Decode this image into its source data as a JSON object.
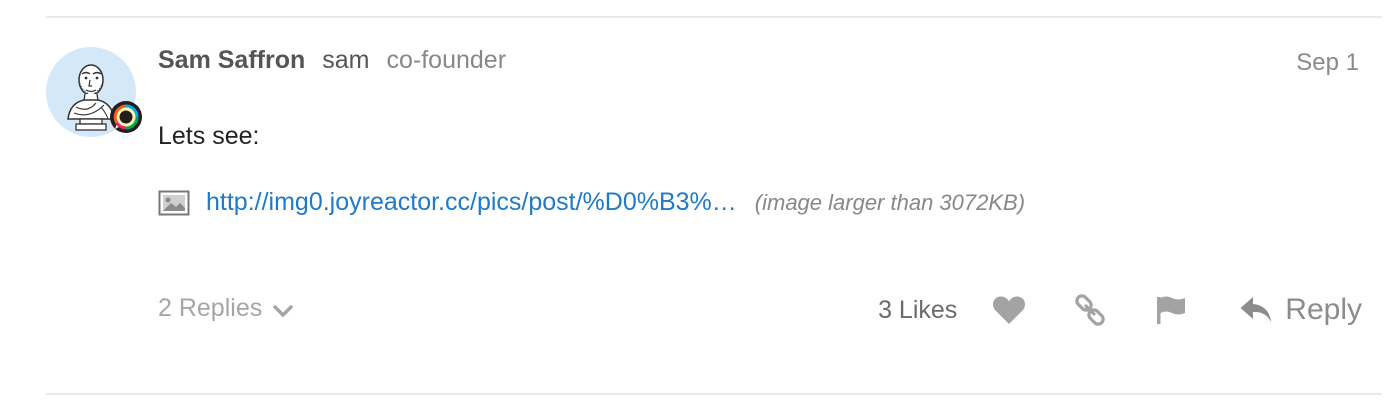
{
  "post": {
    "author": {
      "full_name": "Sam Saffron",
      "username": "sam",
      "title": "co-founder",
      "avatar_icon": "bust-avatar-icon",
      "badge_icon": "discourse-badge-icon"
    },
    "date": "Sep 1",
    "body_text": "Lets see:",
    "onebox": {
      "icon": "image-icon",
      "link_text": "http://img0.joyreactor.cc/pics/post/%D0%B3%…",
      "note": "(image larger than 3072KB)"
    }
  },
  "footer": {
    "replies_label": "2 Replies",
    "replies_icon": "chevron-down-icon",
    "likes_label": "3 Likes",
    "like_icon": "heart-icon",
    "share_icon": "link-icon",
    "flag_icon": "flag-icon",
    "reply_label": "Reply",
    "reply_icon": "reply-arrow-icon"
  },
  "colors": {
    "link": "#1f7ac8",
    "muted": "#a6a6a6",
    "divider": "#e9e9e9",
    "avatar_bg": "#d5e8f8"
  }
}
